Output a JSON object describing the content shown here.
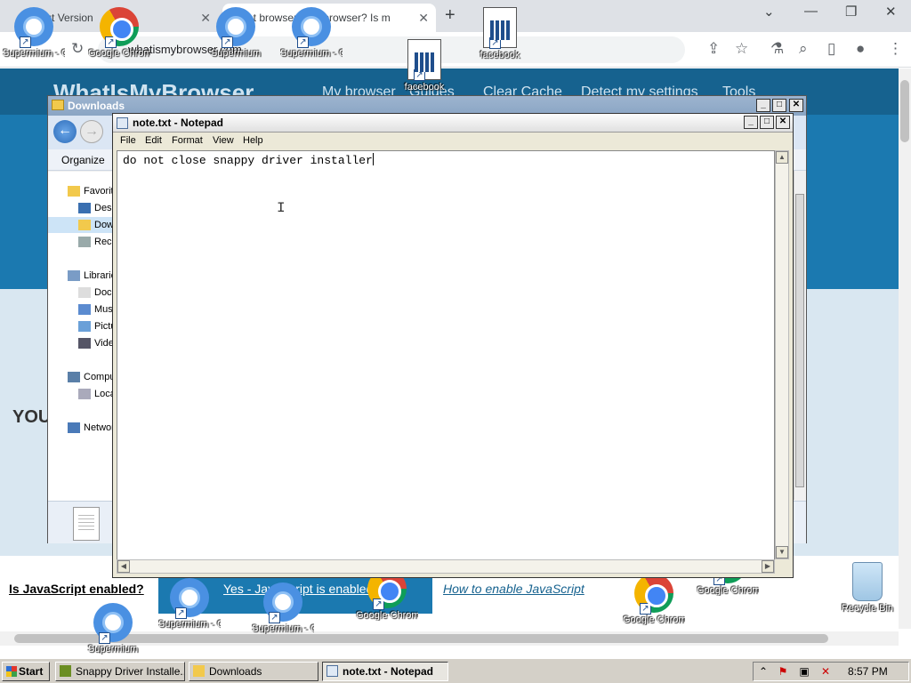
{
  "browser": {
    "tabs": [
      {
        "label": "About Version"
      },
      {
        "label": "What browser? My browser? Is m"
      }
    ],
    "new_tab": "+",
    "window_controls": [
      "⌄",
      "—",
      "❐",
      "✕"
    ],
    "omnibox_text": "whatismybrowser.com",
    "site": {
      "logo": "WhatIsMyBrowser",
      "nav": [
        "My browser",
        "Guides",
        "Clear Cache",
        "Detect my settings",
        "Tools"
      ],
      "you_text": "YOU",
      "js_question": "Is JavaScript enabled?",
      "js_yes": "Yes - JavaScript is enabled",
      "js_how": "How to enable JavaScript"
    }
  },
  "desktop_icons": [
    {
      "label": "Supermium - Copy (3)",
      "type": "supermium"
    },
    {
      "label": "Google Chrome",
      "type": "chrome"
    },
    {
      "label": "Supermium",
      "type": "supermium"
    },
    {
      "label": "Supermium - Copy (5) - ...",
      "type": "supermium"
    },
    {
      "label": "facebook",
      "type": "facebook"
    },
    {
      "label": "facebook",
      "type": "facebook"
    },
    {
      "label": "Supermium - Copy (4)",
      "type": "supermium"
    },
    {
      "label": "Supermium - Copy (5)",
      "type": "supermium"
    },
    {
      "label": "Google Chrome - C...",
      "type": "chrome"
    },
    {
      "label": "Google Chrome - C...",
      "type": "chrome"
    },
    {
      "label": "Google Chrome - C...",
      "type": "chrome"
    },
    {
      "label": "Supermium",
      "type": "supermium"
    },
    {
      "label": "Recycle Bin",
      "type": "recycle"
    }
  ],
  "explorer": {
    "title": "Downloads",
    "organize": "Organize",
    "nav_items": [
      {
        "label": "Favorites",
        "icon": "star-icon"
      },
      {
        "label": "Desktop",
        "icon": "desktop-icon"
      },
      {
        "label": "Downloads",
        "icon": "downloads-icon",
        "selected": true
      },
      {
        "label": "Recent Places",
        "icon": "recent-icon"
      },
      {
        "label": "Libraries",
        "icon": "library-icon"
      },
      {
        "label": "Documents",
        "icon": "documents-icon"
      },
      {
        "label": "Music",
        "icon": "music-icon"
      },
      {
        "label": "Pictures",
        "icon": "pictures-icon"
      },
      {
        "label": "Videos",
        "icon": "videos-icon"
      },
      {
        "label": "Computer",
        "icon": "computer-icon"
      },
      {
        "label": "Local Disk (C:)",
        "icon": "disk-icon"
      },
      {
        "label": "Network",
        "icon": "network-icon"
      }
    ]
  },
  "notepad": {
    "title": "note.txt - Notepad",
    "menu": [
      "File",
      "Edit",
      "Format",
      "View",
      "Help"
    ],
    "content": "do not close snappy driver installer"
  },
  "taskbar": {
    "start": "Start",
    "tasks": [
      {
        "label": "Snappy Driver Installe...",
        "active": false
      },
      {
        "label": "Downloads",
        "active": false
      },
      {
        "label": "note.txt - Notepad",
        "active": true
      }
    ],
    "clock": "8:57 PM"
  },
  "colors": {
    "site_header": "#16628f",
    "site_band": "#1b79b0",
    "taskbar": "#d4d0c8"
  }
}
